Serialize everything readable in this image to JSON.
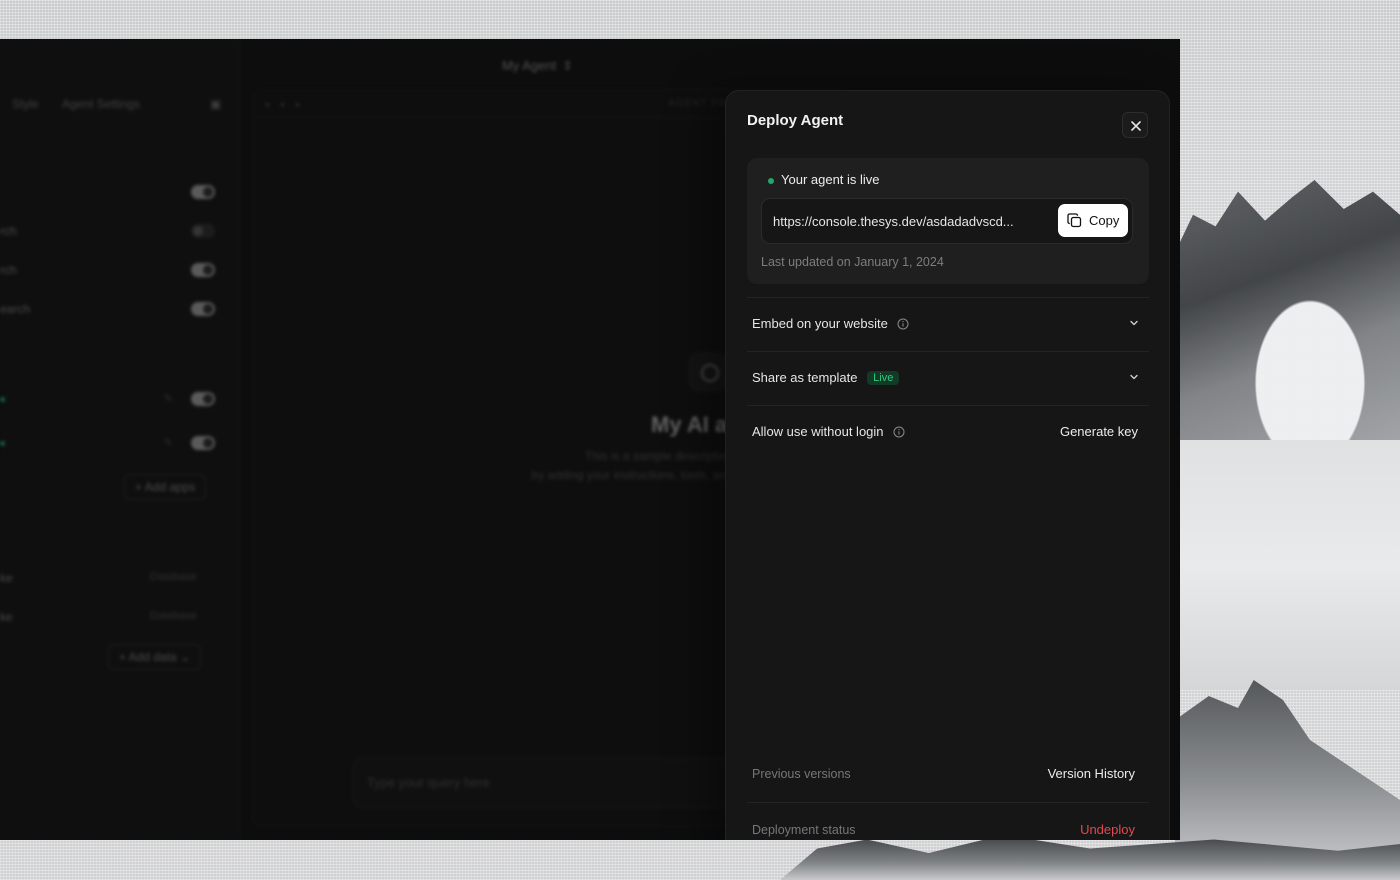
{
  "background": {
    "sky_color": "#c9cbcc"
  },
  "app": {
    "top_title": "My Agent",
    "left_panel": {
      "tabs": [
        "Style",
        "Agent Settings"
      ],
      "toggle_rows": [
        {
          "label": "",
          "on": true
        },
        {
          "label": "rch",
          "on": false
        },
        {
          "label": "rch",
          "on": true
        },
        {
          "label": "earch",
          "on": true
        }
      ],
      "app_rows": [
        {
          "on": true
        },
        {
          "on": true
        }
      ],
      "add_apps_label": "+ Add apps",
      "data_rows": [
        {
          "label": "ke",
          "type": "Database"
        },
        {
          "label": "ke",
          "type": "Database"
        }
      ],
      "add_data_label": "+ Add data"
    },
    "preview": {
      "header_label": "AGENT PR",
      "heading": "My AI ag",
      "description_line1": "This is a sample description",
      "description_line2": "by adding your instructions, tools, and",
      "query_placeholder": "Type your query here"
    }
  },
  "modal": {
    "title": "Deploy Agent",
    "status": {
      "text": "Your agent is live",
      "dot_color": "#1ea86b",
      "url": "https://console.thesys.dev/asdadadvscd...",
      "copy_label": "Copy",
      "updated": "Last updated on January 1, 2024"
    },
    "sections": [
      {
        "label": "Embed on your website",
        "has_info": true
      },
      {
        "label": "Share as template",
        "badge": "Live"
      },
      {
        "label": "Allow use without login",
        "has_info": true,
        "action": "Generate key"
      }
    ],
    "footer": {
      "versions_label": "Previous versions",
      "versions_action": "Version History",
      "status_label": "Deployment status",
      "status_action": "Undeploy",
      "danger_color": "#e5484d"
    }
  }
}
